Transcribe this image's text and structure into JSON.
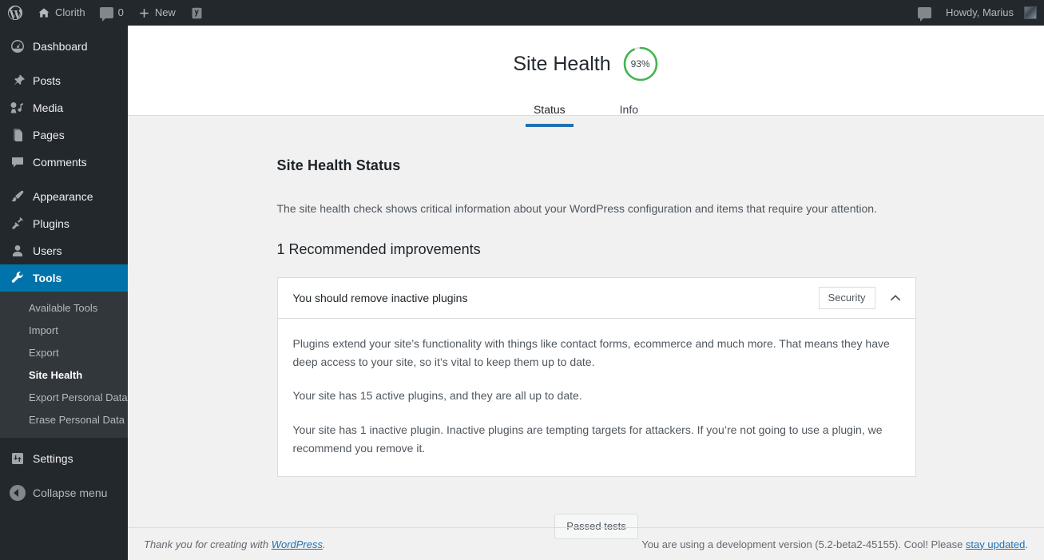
{
  "adminbar": {
    "wp_logo_icon": "wordpress-logo-icon",
    "site_home_icon": "home-icon",
    "site_name": "Clorith",
    "comments_icon": "comment-bubble-icon",
    "comments_count": "0",
    "new_icon": "plus-icon",
    "new_label": "New",
    "seo_icon": "yoast-seo-icon",
    "notifications_icon": "comment-bubble-icon",
    "howdy": "Howdy, Marius",
    "avatar_icon": "avatar-icon"
  },
  "sidebar": {
    "items": [
      {
        "label": "Dashboard",
        "icon": "dashboard-icon",
        "current": false
      },
      {
        "label": "Posts",
        "icon": "pin-icon",
        "current": false
      },
      {
        "label": "Media",
        "icon": "media-icon",
        "current": false
      },
      {
        "label": "Pages",
        "icon": "pages-icon",
        "current": false
      },
      {
        "label": "Comments",
        "icon": "comment-bubble-icon",
        "current": false
      },
      {
        "label": "Appearance",
        "icon": "paintbrush-icon",
        "current": false
      },
      {
        "label": "Plugins",
        "icon": "plug-icon",
        "current": false
      },
      {
        "label": "Users",
        "icon": "user-icon",
        "current": false
      },
      {
        "label": "Tools",
        "icon": "wrench-icon",
        "current": true
      },
      {
        "label": "Settings",
        "icon": "settings-sliders-icon",
        "current": false
      }
    ],
    "tools_submenu": [
      {
        "label": "Available Tools",
        "current": false
      },
      {
        "label": "Import",
        "current": false
      },
      {
        "label": "Export",
        "current": false
      },
      {
        "label": "Site Health",
        "current": true
      },
      {
        "label": "Export Personal Data",
        "current": false
      },
      {
        "label": "Erase Personal Data",
        "current": false
      }
    ],
    "collapse_label": "Collapse menu",
    "collapse_icon": "collapse-arrow-icon"
  },
  "header": {
    "title": "Site Health",
    "score_percent": "93%",
    "score_value": 93,
    "score_color": "#46b450",
    "tabs": [
      {
        "label": "Status",
        "active": true
      },
      {
        "label": "Info",
        "active": false
      }
    ]
  },
  "main": {
    "status_heading": "Site Health Status",
    "status_description": "The site health check shows critical information about your WordPress configuration and items that require your attention.",
    "improvements_heading": "1 Recommended improvements",
    "issue": {
      "title": "You should remove inactive plugins",
      "badge": "Security",
      "expanded": true,
      "chevron_icon": "chevron-up-icon",
      "paragraphs": [
        "Plugins extend your site’s functionality with things like contact forms, ecommerce and much more. That means they have deep access to your site, so it’s vital to keep them up to date.",
        "Your site has 15 active plugins, and they are all up to date.",
        "Your site has 1 inactive plugin. Inactive plugins are tempting targets for attackers. If you’re not going to use a plugin, we recommend you remove it."
      ]
    },
    "passed_tests_label": "Passed tests"
  },
  "footer": {
    "thanks_prefix": "Thank you for creating with ",
    "thanks_link": "WordPress",
    "thanks_suffix": ".",
    "version_prefix": "You are using a development version (5.2-beta2-45155). Cool! Please ",
    "version_link": "stay updated",
    "version_suffix": "."
  },
  "colors": {
    "admin_dark": "#23282d",
    "admin_submenu": "#32373c",
    "accent_blue": "#0073aa",
    "tab_blue": "#2271b1",
    "green": "#46b450",
    "content_bg": "#f1f1f1"
  }
}
